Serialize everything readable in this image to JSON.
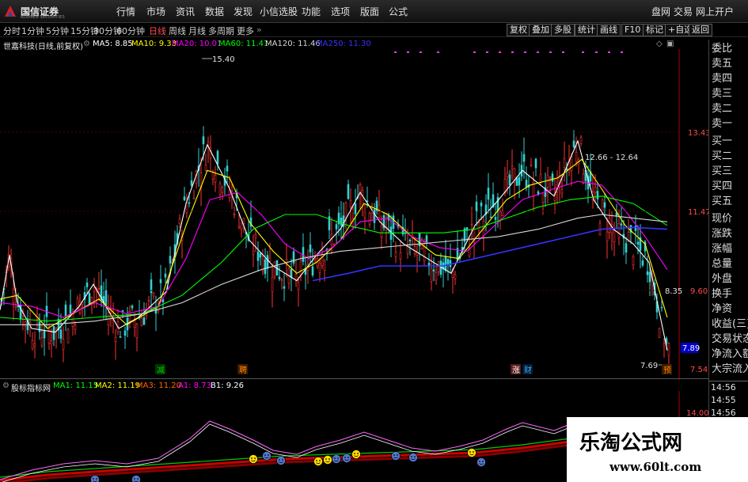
{
  "app": {
    "logo_text": "国信证券",
    "logo_sub": "GUOSEN SECURITIES",
    "menu": [
      "行情",
      "市场",
      "资讯",
      "数据",
      "发现",
      "小信选股",
      "功能",
      "选项",
      "版面",
      "公式"
    ],
    "menu_right": [
      "盘网",
      "交易",
      "网上开户"
    ]
  },
  "toolbar": {
    "periods": [
      "分时",
      "1分钟",
      "5分钟",
      "15分钟",
      "30分钟",
      "60分钟",
      "日线",
      "周线",
      "月线",
      "多周期",
      "更多"
    ],
    "active_period": "日线",
    "buttons": [
      "复权",
      "叠加",
      "多股",
      "统计",
      "画线",
      "F10",
      "标记",
      "+自选",
      "返回"
    ]
  },
  "chart_header": {
    "title": "世嘉科技(日线,前复权)",
    "ma": [
      {
        "label": "MA5: 8.85",
        "color": "#ffffff"
      },
      {
        "label": "MA10: 9.33",
        "color": "#ffff00"
      },
      {
        "label": "MA20: 10.01",
        "color": "#ff00ff"
      },
      {
        "label": "MA60: 11.41",
        "color": "#00ff00"
      },
      {
        "label": "MA120: 11.46",
        "color": "#d8d8d8"
      },
      {
        "label": "MA250: 11.30",
        "color": "#3333ff"
      }
    ]
  },
  "price_axis": {
    "labels": [
      "13.43",
      "11.47",
      "9.60",
      "7.54"
    ],
    "current_price": "7.89"
  },
  "annotations": {
    "high": "15.40",
    "low": "7.69",
    "range": "12.66 - 12.64",
    "mid": "8.35"
  },
  "signals": [
    {
      "text": "减",
      "color": "#00cc00",
      "bg": "#003300"
    },
    {
      "text": "聘",
      "color": "#ff8800",
      "bg": "#3a1a00"
    },
    {
      "text": "涨",
      "color": "#ffffff",
      "bg": "#5a1a1a"
    },
    {
      "text": "财",
      "color": "#44aaff",
      "bg": "#001a33"
    },
    {
      "text": "预",
      "color": "#ff8800",
      "bg": "#3a1a00"
    }
  ],
  "indicator": {
    "name": "股标指标网",
    "values": [
      {
        "label": "MA1: 11.15",
        "color": "#00ff00"
      },
      {
        "label": "MA2: 11.19",
        "color": "#ffff00"
      },
      {
        "label": "MA3: 11.20",
        "color": "#ff6600"
      },
      {
        "label": "A1: 8.73",
        "color": "#ff00ff"
      },
      {
        "label": "B1: 9.26",
        "color": "#ffffff"
      }
    ],
    "axis_label": "14.00"
  },
  "side_panel": {
    "labels": [
      "委比",
      "卖五",
      "卖四",
      "卖三",
      "卖二",
      "卖一",
      "买一",
      "买二",
      "买三",
      "买四",
      "买五",
      "现价",
      "涨跌",
      "涨幅",
      "总量",
      "外盘",
      "换手",
      "净资",
      "收益(三)",
      "交易状态",
      "净流入额",
      "大宗流入"
    ],
    "times": [
      "14:56",
      "14:55",
      "14:56",
      "14:56",
      "14:56"
    ]
  },
  "watermark": {
    "cn": "乐淘公式网",
    "url": "www.60lt.com"
  },
  "chart_data": {
    "type": "line",
    "title": "世嘉科技(日线,前复权)",
    "xlabel": "",
    "ylabel": "",
    "ylim": [
      7.2,
      16.2
    ],
    "grid": false,
    "series": [
      {
        "name": "MA5",
        "color": "#ffffff",
        "values": [
          [
            0,
            9.1
          ],
          [
            12,
            10.6
          ],
          [
            22,
            9.3
          ],
          [
            40,
            8.6
          ],
          [
            70,
            8.5
          ],
          [
            100,
            9.2
          ],
          [
            118,
            9.8
          ],
          [
            150,
            8.6
          ],
          [
            175,
            8.9
          ],
          [
            210,
            9.6
          ],
          [
            235,
            12.0
          ],
          [
            262,
            13.6
          ],
          [
            290,
            12.4
          ],
          [
            315,
            11.0
          ],
          [
            345,
            10.3
          ],
          [
            375,
            9.9
          ],
          [
            400,
            10.6
          ],
          [
            430,
            11.3
          ],
          [
            455,
            12.3
          ],
          [
            480,
            11.5
          ],
          [
            510,
            10.9
          ],
          [
            540,
            10.5
          ],
          [
            570,
            10.1
          ],
          [
            600,
            11.4
          ],
          [
            630,
            12.1
          ],
          [
            660,
            12.9
          ],
          [
            700,
            12.2
          ],
          [
            730,
            13.7
          ],
          [
            750,
            12.1
          ],
          [
            775,
            11.3
          ],
          [
            800,
            10.9
          ],
          [
            820,
            10.4
          ],
          [
            843,
            8.0
          ]
        ]
      },
      {
        "name": "MA10",
        "color": "#ffff00",
        "values": [
          [
            0,
            9.4
          ],
          [
            22,
            9.5
          ],
          [
            60,
            8.6
          ],
          [
            100,
            9.1
          ],
          [
            125,
            9.4
          ],
          [
            160,
            8.7
          ],
          [
            200,
            9.2
          ],
          [
            235,
            11.4
          ],
          [
            262,
            12.9
          ],
          [
            290,
            12.7
          ],
          [
            315,
            11.5
          ],
          [
            345,
            10.7
          ],
          [
            375,
            10.1
          ],
          [
            400,
            10.4
          ],
          [
            430,
            11.0
          ],
          [
            460,
            12.0
          ],
          [
            490,
            11.7
          ],
          [
            520,
            11.1
          ],
          [
            550,
            10.6
          ],
          [
            580,
            10.5
          ],
          [
            610,
            11.3
          ],
          [
            640,
            12.1
          ],
          [
            670,
            12.5
          ],
          [
            705,
            12.7
          ],
          [
            735,
            13.2
          ],
          [
            760,
            12.4
          ],
          [
            790,
            11.4
          ],
          [
            815,
            10.9
          ],
          [
            843,
            8.9
          ]
        ]
      },
      {
        "name": "MA20",
        "color": "#ff00ff",
        "values": [
          [
            0,
            9.3
          ],
          [
            40,
            9.2
          ],
          [
            80,
            8.9
          ],
          [
            120,
            9.3
          ],
          [
            160,
            9.0
          ],
          [
            200,
            9.2
          ],
          [
            235,
            10.5
          ],
          [
            265,
            12.1
          ],
          [
            300,
            12.3
          ],
          [
            330,
            11.7
          ],
          [
            360,
            10.9
          ],
          [
            390,
            10.5
          ],
          [
            420,
            10.8
          ],
          [
            455,
            11.5
          ],
          [
            490,
            11.6
          ],
          [
            520,
            11.1
          ],
          [
            555,
            10.8
          ],
          [
            590,
            10.7
          ],
          [
            625,
            11.4
          ],
          [
            660,
            12.1
          ],
          [
            700,
            12.4
          ],
          [
            730,
            12.6
          ],
          [
            760,
            12.5
          ],
          [
            790,
            11.8
          ],
          [
            815,
            11.1
          ],
          [
            843,
            10.2
          ]
        ]
      },
      {
        "name": "MA60",
        "color": "#00ff00",
        "values": [
          [
            0,
            8.9
          ],
          [
            60,
            8.8
          ],
          [
            120,
            8.9
          ],
          [
            180,
            9.0
          ],
          [
            230,
            9.5
          ],
          [
            280,
            10.4
          ],
          [
            320,
            11.3
          ],
          [
            360,
            11.7
          ],
          [
            400,
            11.7
          ],
          [
            440,
            11.4
          ],
          [
            480,
            11.2
          ],
          [
            520,
            11.2
          ],
          [
            560,
            11.2
          ],
          [
            600,
            11.3
          ],
          [
            640,
            11.6
          ],
          [
            680,
            11.9
          ],
          [
            720,
            12.1
          ],
          [
            760,
            12.2
          ],
          [
            800,
            12.0
          ],
          [
            843,
            11.4
          ]
        ]
      },
      {
        "name": "MA120",
        "color": "#d8d8d8",
        "values": [
          [
            0,
            8.7
          ],
          [
            60,
            8.7
          ],
          [
            120,
            8.8
          ],
          [
            180,
            9.0
          ],
          [
            230,
            9.3
          ],
          [
            280,
            9.8
          ],
          [
            330,
            10.2
          ],
          [
            380,
            10.5
          ],
          [
            430,
            10.7
          ],
          [
            480,
            10.8
          ],
          [
            530,
            10.9
          ],
          [
            580,
            11.0
          ],
          [
            630,
            11.1
          ],
          [
            680,
            11.3
          ],
          [
            730,
            11.6
          ],
          [
            760,
            11.7
          ],
          [
            800,
            11.6
          ],
          [
            843,
            11.5
          ]
        ]
      },
      {
        "name": "MA250",
        "color": "#3333ff",
        "values": [
          [
            395,
            9.9
          ],
          [
            440,
            10.1
          ],
          [
            480,
            10.3
          ],
          [
            520,
            10.3
          ],
          [
            560,
            10.3
          ],
          [
            600,
            10.5
          ],
          [
            640,
            10.7
          ],
          [
            680,
            10.9
          ],
          [
            720,
            11.1
          ],
          [
            760,
            11.3
          ],
          [
            800,
            11.35
          ],
          [
            843,
            11.3
          ]
        ]
      }
    ]
  }
}
